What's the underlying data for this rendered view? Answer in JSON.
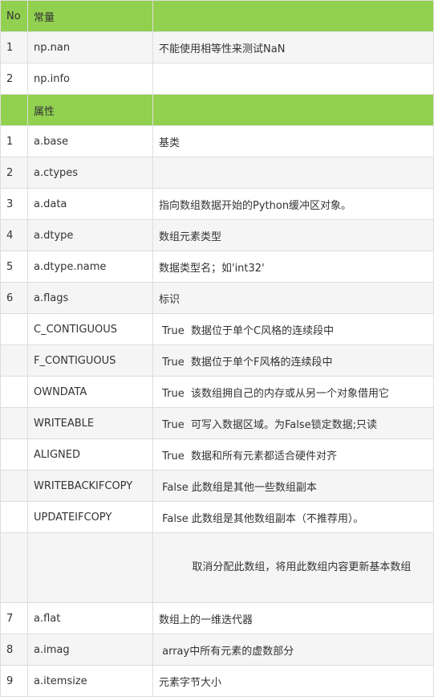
{
  "table": {
    "header": {
      "no": "No",
      "col2": "常量",
      "col3": ""
    },
    "constants": [
      {
        "no": "1",
        "name": "np.nan",
        "desc": "不能使用相等性来测试NaN"
      },
      {
        "no": "2",
        "name": "np.info",
        "desc": ""
      }
    ],
    "section_header": {
      "no": "",
      "col2": "属性",
      "col3": ""
    },
    "attributes": [
      {
        "no": "1",
        "name": "a.base",
        "desc": "基类"
      },
      {
        "no": "2",
        "name": "a.ctypes",
        "desc": ""
      },
      {
        "no": "3",
        "name": "a.data",
        "desc": "指向数组数据开始的Python缓冲区对象。"
      },
      {
        "no": "4",
        "name": "a.dtype",
        "desc": "数组元素类型"
      },
      {
        "no": "5",
        "name": "a.dtype.name",
        "desc": "数据类型名；如'int32'"
      },
      {
        "no": "6",
        "name": "a.flags",
        "desc": "标识"
      },
      {
        "no": "",
        "name": "C_CONTIGUOUS",
        "desc": " True  数据位于单个C风格的连续段中"
      },
      {
        "no": "",
        "name": "F_CONTIGUOUS",
        "desc": " True  数据位于单个F风格的连续段中"
      },
      {
        "no": "",
        "name": "OWNDATA",
        "desc": " True  该数组拥自己的内存或从另一个对象借用它"
      },
      {
        "no": "",
        "name": "WRITEABLE",
        "desc": " True  可写入数据区域。为False锁定数据;只读"
      },
      {
        "no": "",
        "name": "ALIGNED",
        "desc": " True  数据和所有元素都适合硬件对齐"
      },
      {
        "no": "",
        "name": "WRITEBACKIFCOPY",
        "desc": " False 此数组是其他一些数组副本"
      },
      {
        "no": "",
        "name": "UPDATEIFCOPY",
        "desc": " False 此数组是其他数组副本（不推荐用）。"
      },
      {
        "no": "",
        "name": "",
        "desc": "          取消分配此数组，将用此数组内容更新基本数组"
      },
      {
        "no": "7",
        "name": "a.flat",
        "desc": "数组上的一维迭代器"
      },
      {
        "no": "8",
        "name": "a.imag",
        "desc": " array中所有元素的虚数部分"
      },
      {
        "no": "9",
        "name": "a.itemsize",
        "desc": "元素字节大小"
      }
    ]
  }
}
